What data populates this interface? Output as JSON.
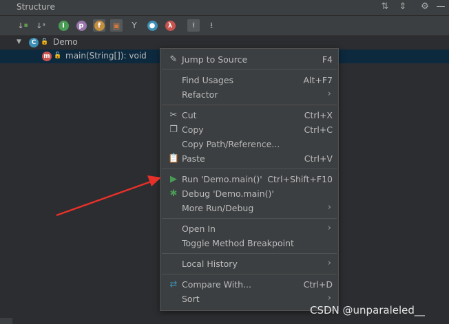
{
  "panel": {
    "title": "Structure"
  },
  "tree": {
    "class_name": "Demo",
    "class_icon_letter": "C",
    "method_name": "main(String[]): void",
    "method_icon_letter": "m"
  },
  "toolbar_icons": [
    {
      "name": "sort-by-visibility-icon",
      "glyph": "↓"
    },
    {
      "name": "sort-alphabetically-icon",
      "glyph": "↓a"
    },
    {
      "name": "show-inherited-icon",
      "glyph": "I"
    },
    {
      "name": "show-properties-icon",
      "glyph": "p"
    },
    {
      "name": "show-fields-icon",
      "glyph": "f"
    },
    {
      "name": "show-non-public-icon",
      "glyph": "🔒"
    },
    {
      "name": "show-anonymous-icon",
      "glyph": "Y"
    },
    {
      "name": "show-lambdas-icon",
      "glyph": "o"
    },
    {
      "name": "lambda-icon",
      "glyph": "λ"
    },
    {
      "name": "autoscroll-to-source-icon",
      "glyph": "⇧"
    },
    {
      "name": "autoscroll-from-source-icon",
      "glyph": "⇩"
    }
  ],
  "menu": {
    "jump_to_source": "Jump to Source",
    "jump_to_source_sc": "F4",
    "find_usages": "Find Usages",
    "find_usages_sc": "Alt+F7",
    "refactor": "Refactor",
    "cut": "Cut",
    "cut_sc": "Ctrl+X",
    "copy": "Copy",
    "copy_sc": "Ctrl+C",
    "copy_path": "Copy Path/Reference...",
    "paste": "Paste",
    "paste_sc": "Ctrl+V",
    "run": "Run 'Demo.main()'",
    "run_sc": "Ctrl+Shift+F10",
    "debug": "Debug 'Demo.main()'",
    "more_run": "More Run/Debug",
    "open_in": "Open In",
    "toggle_breakpoint": "Toggle Method Breakpoint",
    "local_history": "Local History",
    "compare_with": "Compare With...",
    "compare_with_sc": "Ctrl+D",
    "sort": "Sort"
  },
  "watermark": "CSDN @unparaleled__",
  "colors": {
    "run_green": "#499c54",
    "arrow_red": "#e8302a",
    "selection": "#0d293e"
  }
}
